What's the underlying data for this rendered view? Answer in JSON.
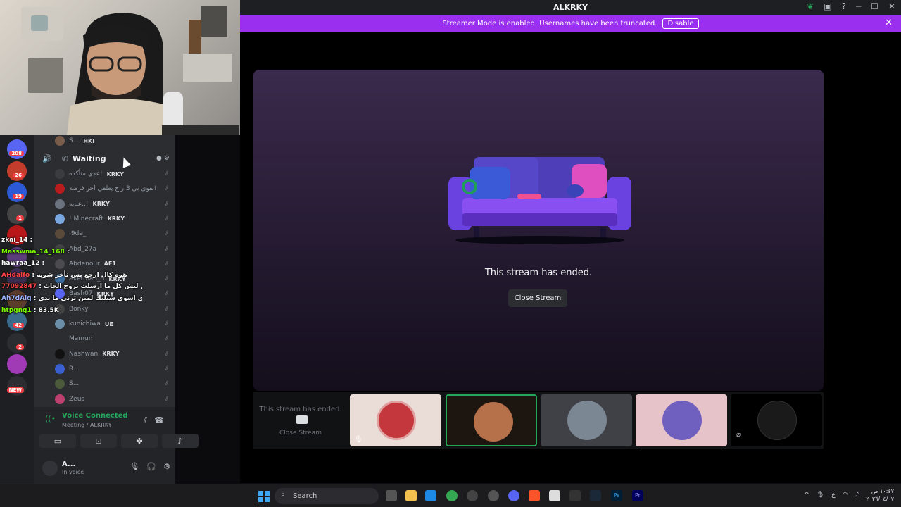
{
  "window": {
    "title": "ALKRKY"
  },
  "streamer_banner": {
    "text": "Streamer Mode is enabled. Usernames have been truncated.",
    "disable_label": "Disable"
  },
  "stage": {
    "ended_text": "This stream has ended.",
    "close_label": "Close Stream"
  },
  "thumbs": {
    "ended_text": "This stream has ended.",
    "close_label": "Close Stream"
  },
  "channel": {
    "name": "Waiting",
    "top_user": "S...",
    "top_tag": "HKI"
  },
  "servers": [
    {
      "badge": "208",
      "color": "#5865f2"
    },
    {
      "badge": "26",
      "color": "#c43c2c"
    },
    {
      "badge": "19",
      "color": "#2c59d6"
    },
    {
      "badge": "1",
      "color": "#444"
    },
    {
      "badge": "",
      "color": "#b9171a"
    },
    {
      "badge": "",
      "color": "#5a3d7a"
    },
    {
      "badge": "",
      "color": "#3b2d4f"
    },
    {
      "badge": "",
      "color": "#5c3c2a"
    },
    {
      "badge": "42",
      "color": "#3a6b8a"
    },
    {
      "badge": "2",
      "color": "#2b2d31"
    },
    {
      "badge": "",
      "color": "#a13bb5"
    },
    {
      "badge": "NEW",
      "color": "#2b2d31"
    }
  ],
  "voice_members": [
    {
      "name": "عدي متأكده!",
      "tag": "KRKY"
    },
    {
      "name": "تقوى بي 3 راح يطفي اخر فرصة!",
      "tag": ""
    },
    {
      "name": "عبايه..!",
      "tag": "KRKY"
    },
    {
      "name": "! Minecraft",
      "tag": "KRKY"
    },
    {
      "name": ".9de_",
      "tag": ""
    },
    {
      "name": "Abd_27a",
      "tag": ""
    },
    {
      "name": "Abdenour",
      "tag": "AF1"
    },
    {
      "name": "Akerman_S",
      "tag": "KRKY"
    },
    {
      "name": "Bash07",
      "tag": "KRKY"
    },
    {
      "name": "Bonky",
      "tag": ""
    },
    {
      "name": "kunichiwa",
      "tag": "UE"
    },
    {
      "name": "Mamun",
      "tag": ""
    },
    {
      "name": "Nashwan",
      "tag": "KRKY"
    },
    {
      "name": "R...",
      "tag": ""
    },
    {
      "name": "S...",
      "tag": ""
    },
    {
      "name": "Zeus",
      "tag": ""
    }
  ],
  "chat_overlay": [
    {
      "user": "zkai_14",
      "msg": "",
      "color": "#ffffff"
    },
    {
      "user": "Masswma_14_168",
      "msg": "",
      "color": "#7cfc00"
    },
    {
      "user": "hawraa_12",
      "msg": "",
      "color": "#ffffff"
    },
    {
      "user": "AHdalfo",
      "msg": "هوه كال ارجع بس تأخر شويه",
      "color": "#ff4444"
    },
    {
      "user": "77092847",
      "msg": "والا شبابي ليش كل ما ارسلت يروح الجاث",
      "color": "#ff4444"
    },
    {
      "user": "Ah7dAlq",
      "msg": "جاي اسوي شيلتك لمين ترني ما يدي",
      "color": "#9ab6ff"
    },
    {
      "user": "htpgng1",
      "msg": "83.5K",
      "color": "#7cfc00"
    }
  ],
  "voice_connected": {
    "title": "Voice Connected",
    "subtitle": "Meeting / ALKRKY"
  },
  "me": {
    "name": "A...",
    "status": "In voice"
  },
  "taskbar": {
    "search": "Search",
    "time": "١٠:٤٧ ص",
    "date": "٢٠٢٦/٠٤/٠٧",
    "lang": "ع"
  }
}
